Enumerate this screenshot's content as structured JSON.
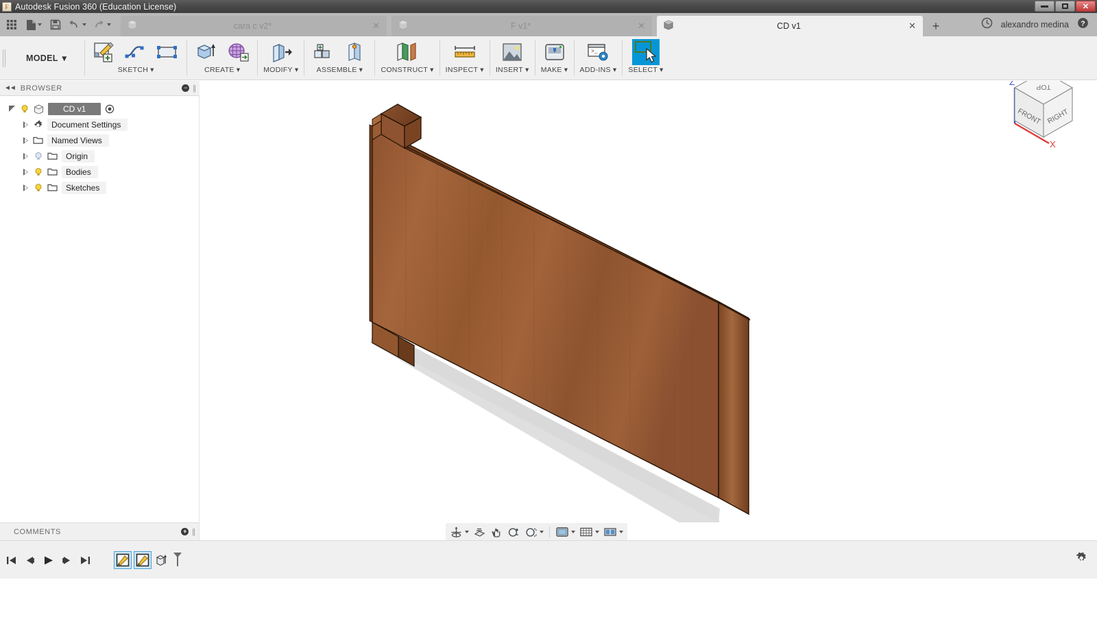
{
  "window": {
    "title": "Autodesk Fusion 360 (Education License)",
    "app_icon": "fusion-logo-icon",
    "minimize_label": "Minimize",
    "restore_label": "Restore",
    "close_label": "Close"
  },
  "quick_access": {
    "show_data_panel_label": "Show Data Panel",
    "file_label": "File",
    "save_label": "Save",
    "undo_label": "Undo",
    "redo_label": "Redo",
    "new_tab_label": "+",
    "recent_icon": "clock-icon",
    "help_icon": "help-icon",
    "user_name": "alexandro medina"
  },
  "tabs": [
    {
      "label": "cara c v2*",
      "active": false,
      "close": "✕",
      "icon": "cube-icon"
    },
    {
      "label": "F v1*",
      "active": false,
      "close": "✕",
      "icon": "cube-icon"
    },
    {
      "label": "CD v1",
      "active": true,
      "close": "✕",
      "icon": "cube-icon"
    }
  ],
  "ribbon": {
    "workspace": {
      "label": "MODEL",
      "caret": "▾"
    },
    "groups": [
      {
        "label": "SKETCH",
        "caret": "▾",
        "tools": [
          "create-sketch-icon",
          "spline-icon",
          "rectangle-icon"
        ]
      },
      {
        "label": "CREATE",
        "caret": "▾",
        "tools": [
          "extrude-icon",
          "create-form-icon"
        ]
      },
      {
        "label": "MODIFY",
        "caret": "▾",
        "tools": [
          "press-pull-icon"
        ]
      },
      {
        "label": "ASSEMBLE",
        "caret": "▾",
        "tools": [
          "new-component-icon",
          "joint-icon"
        ]
      },
      {
        "label": "CONSTRUCT",
        "caret": "▾",
        "tools": [
          "offset-plane-icon"
        ]
      },
      {
        "label": "INSPECT",
        "caret": "▾",
        "tools": [
          "measure-icon"
        ]
      },
      {
        "label": "INSERT",
        "caret": "▾",
        "tools": [
          "insert-image-icon"
        ]
      },
      {
        "label": "MAKE",
        "caret": "▾",
        "tools": [
          "3d-print-icon"
        ]
      },
      {
        "label": "ADD-INS",
        "caret": "▾",
        "tools": [
          "scripts-addins-icon"
        ]
      },
      {
        "label": "SELECT",
        "caret": "▾",
        "tools": [
          "select-window-icon"
        ],
        "selected": true
      }
    ]
  },
  "browser": {
    "header": "BROWSER",
    "collapse_icon": "collapse-left-icon",
    "minus_icon": "−",
    "root": {
      "label": "CD v1",
      "selected": true,
      "bulb": "on",
      "target_icon": "target-icon"
    },
    "items": [
      {
        "label": "Document Settings",
        "icon": "gear-icon",
        "bulb": null,
        "arrow": "collapsed"
      },
      {
        "label": "Named Views",
        "icon": "folder-icon",
        "bulb": null,
        "arrow": "collapsed"
      },
      {
        "label": "Origin",
        "icon": "folder-icon",
        "bulb": "off",
        "arrow": "collapsed"
      },
      {
        "label": "Bodies",
        "icon": "folder-icon",
        "bulb": "on",
        "arrow": "collapsed"
      },
      {
        "label": "Sketches",
        "icon": "folder-icon",
        "bulb": "on",
        "arrow": "collapsed"
      }
    ]
  },
  "comments": {
    "label": "COMMENTS",
    "plus_icon": "+"
  },
  "viewcube": {
    "top_face": "TOP",
    "front_face": "FRONT",
    "right_face": "RIGHT",
    "z_axis": "Z",
    "x_axis": "X",
    "z_color": "#3b4fd8",
    "x_color": "#e03a3a"
  },
  "navbar": {
    "items": [
      {
        "name": "orbit-icon",
        "caret": true
      },
      {
        "name": "look-at-icon",
        "caret": false
      },
      {
        "name": "pan-icon",
        "caret": false
      },
      {
        "name": "zoom-icon",
        "caret": false
      },
      {
        "name": "fit-icon",
        "caret": true
      },
      {
        "name": "display-settings-icon",
        "caret": true
      },
      {
        "name": "grid-snap-icon",
        "caret": true
      },
      {
        "name": "viewports-icon",
        "caret": true
      }
    ]
  },
  "timeline": {
    "controls": [
      "go-to-beginning-icon",
      "step-back-icon",
      "play-icon",
      "step-forward-icon",
      "go-to-end-icon"
    ],
    "features": [
      {
        "name": "sketch-feature-icon",
        "selected": true
      },
      {
        "name": "sketch-feature-icon",
        "selected": true
      },
      {
        "name": "extrude-feature-icon",
        "selected": false
      }
    ],
    "marker": "timeline-marker-icon",
    "settings_icon": "gear-icon"
  },
  "model": {
    "name": "wooden-panel-body",
    "base_color": "#9a5a32",
    "light_color": "#b87048",
    "dark_color": "#6e3c1f",
    "edge_color": "#2a1608",
    "shadow_color": "#d8d8d8"
  }
}
